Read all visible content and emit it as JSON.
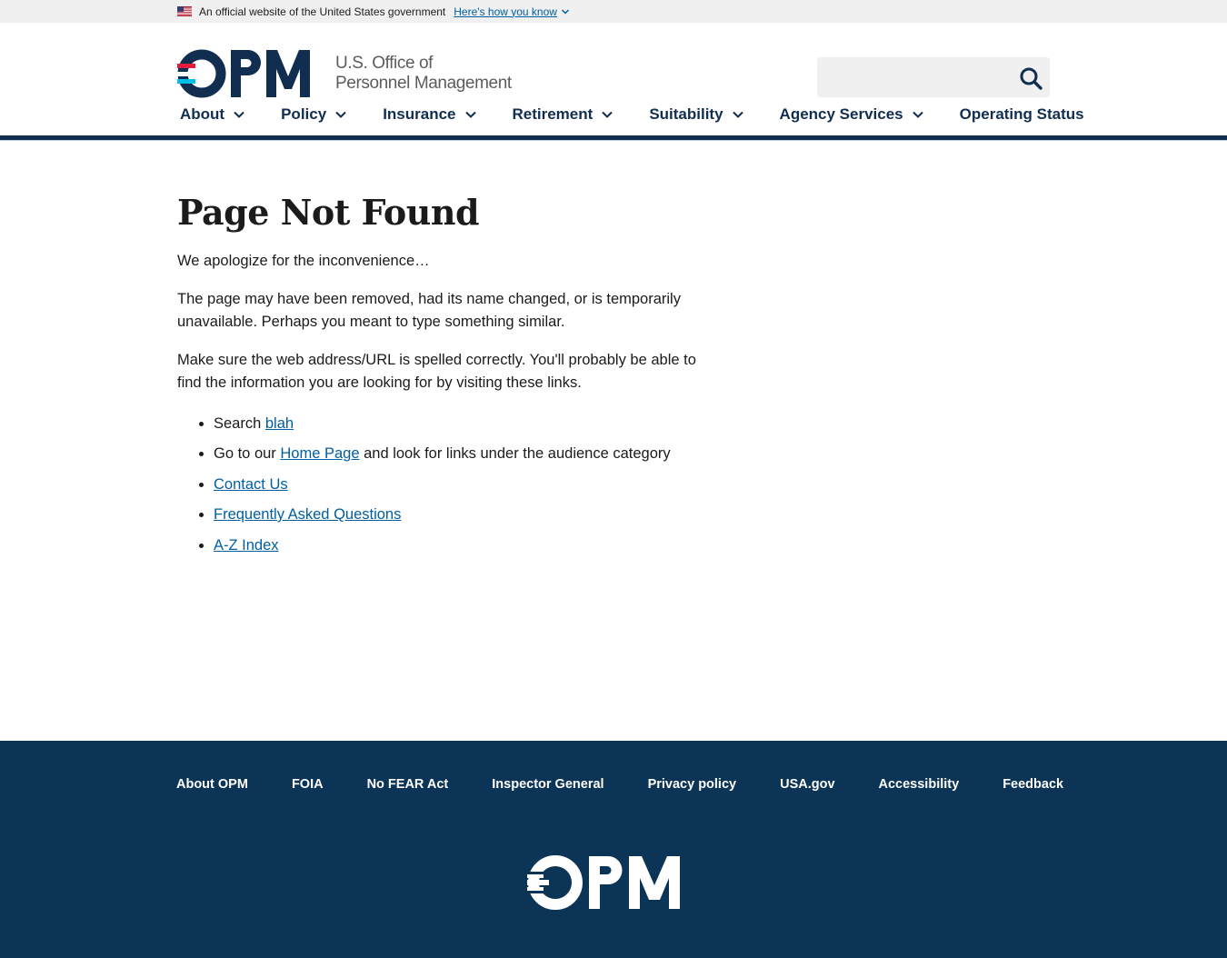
{
  "gov_banner": {
    "text": "An official website of the United States government",
    "link_label": "Here's how you know"
  },
  "header": {
    "logo_text": "OPM",
    "agency_line1": "U.S. Office of",
    "agency_line2": "Personnel Management",
    "search": {
      "placeholder": "",
      "value": ""
    }
  },
  "nav": {
    "items": [
      {
        "label": "About",
        "has_dropdown": true
      },
      {
        "label": "Policy",
        "has_dropdown": true
      },
      {
        "label": "Insurance",
        "has_dropdown": true
      },
      {
        "label": "Retirement",
        "has_dropdown": true
      },
      {
        "label": "Suitability",
        "has_dropdown": true
      },
      {
        "label": "Agency Services",
        "has_dropdown": true
      },
      {
        "label": "Operating Status",
        "has_dropdown": false
      }
    ]
  },
  "main": {
    "title": "Page Not Found",
    "para1": "We apologize for the inconvenience…",
    "para2": "The page may have been removed, had its name changed, or is temporarily unavailable. Perhaps you meant to type something similar.",
    "para3": "Make sure the web address/URL is spelled correctly. You'll probably be able to find the information you are looking for by visiting these links.",
    "links": {
      "search_prefix": "Search ",
      "search_link": "blah",
      "home_prefix": "Go to our ",
      "home_link": "Home Page",
      "home_suffix": " and look for links under the audience category",
      "contact": "Contact Us",
      "faq": "Frequently Asked Questions",
      "az": "A-Z Index"
    }
  },
  "footer": {
    "links": [
      "About OPM",
      "FOIA",
      "No FEAR Act",
      "Inspector General",
      "Privacy policy",
      "USA.gov",
      "Accessibility",
      "Feedback"
    ],
    "logo_text": "OPM"
  },
  "colors": {
    "navy": "#112e51",
    "footer_bg": "#0b3456",
    "link": "#005ea2",
    "logo_red": "#e31c3d",
    "logo_blue": "#02bfe7"
  },
  "icons": {
    "flag": "us-flag-icon",
    "search": "search-icon",
    "chevron": "chevron-down-icon"
  }
}
